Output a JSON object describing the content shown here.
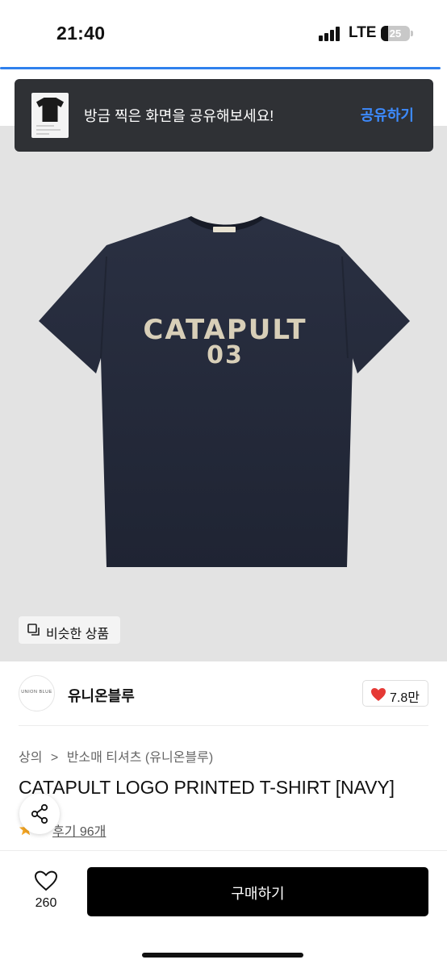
{
  "status_bar": {
    "time": "21:40",
    "network": "LTE",
    "battery_level": "25"
  },
  "toast": {
    "message": "방금 찍은 화면을 공유해보세요!",
    "action_label": "공유하기",
    "action_color": "#3d8bff"
  },
  "product_image": {
    "print_line1": "CATAPULT",
    "print_line2": "03",
    "shirt_color": "#252b3b"
  },
  "similar_button": {
    "label": "비슷한 상품",
    "icon": "copy-icon"
  },
  "brand": {
    "logo_text": "UNION BLUE",
    "name": "유니온블루",
    "likes": "7.8만",
    "like_icon": "heart-filled-icon",
    "like_color": "#e53935"
  },
  "breadcrumb": {
    "items": [
      "상의",
      "반소매 티셔츠 (유니온블루)"
    ],
    "separator": ">"
  },
  "product": {
    "title": "CATAPULT LOGO PRINTED T-SHIRT [NAVY]",
    "review_label": "후기 96개"
  },
  "bottom_bar": {
    "wish_count": "260",
    "buy_label": "구매하기"
  }
}
